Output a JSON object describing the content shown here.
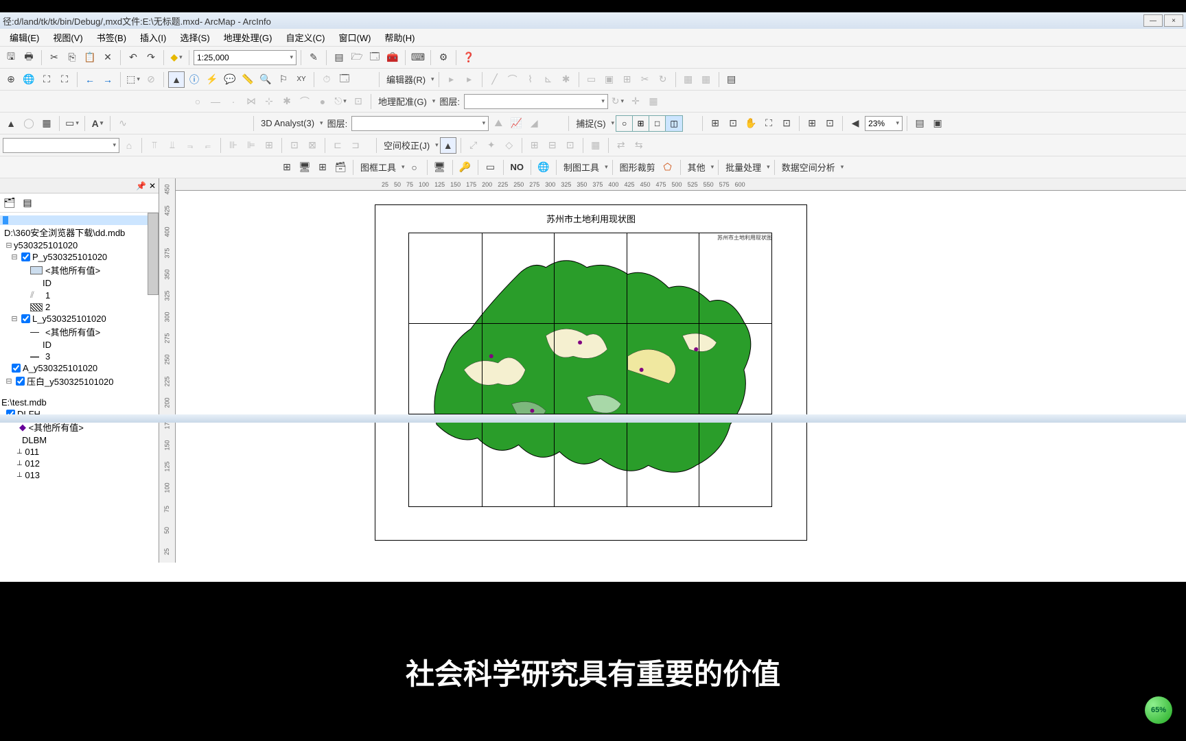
{
  "title": "径:d/land/tk/tk/bin/Debug/,mxd文件:E:\\无标题.mxd- ArcMap - ArcInfo",
  "window_controls": {
    "minimize": "—",
    "close": "×"
  },
  "menu": {
    "edit": "编辑(E)",
    "view": "视图(V)",
    "bookmark": "书签(B)",
    "insert": "插入(I)",
    "select": "选择(S)",
    "geoproc": "地理处理(G)",
    "custom": "自定义(C)",
    "window": "窗口(W)",
    "help": "帮助(H)"
  },
  "scale": "1:25,000",
  "zoom_pct": "23%",
  "editor_label": "编辑器(R)",
  "georef_label": "地理配准(G)",
  "layer_label": "图层:",
  "snap_label": "捕捉(S)",
  "analyst3d_label": "3D Analyst(3)",
  "spatial_adj_label": "空间校正(J)",
  "frame_tool_label": "图框工具",
  "no_label": "NO",
  "carto_tool_label": "制图工具",
  "clip_label": "图形裁剪",
  "other_label": "其他",
  "batch_label": "批量处理",
  "data_spatial_label": "数据空间分析",
  "ruler_h": [
    "25",
    "50",
    "75",
    "100",
    "125",
    "150",
    "175",
    "200",
    "225",
    "250",
    "275",
    "300",
    "325",
    "350",
    "375",
    "400",
    "425",
    "450",
    "475",
    "500",
    "525",
    "550",
    "575",
    "600"
  ],
  "ruler_v": [
    "450",
    "425",
    "400",
    "375",
    "350",
    "325",
    "300",
    "275",
    "250",
    "225",
    "200",
    "175",
    "150",
    "125",
    "100",
    "75",
    "50",
    "25"
  ],
  "map_title": "苏州市土地利用现状图",
  "legend_text": "苏州市土地利用现状图",
  "toc": {
    "db1": "D:\\360安全浏览器下载\\dd.mdb",
    "layer_y": "y530325101020",
    "layer_p": "P_y530325101020",
    "other_vals": "<其他所有值>",
    "id_field": "ID",
    "val_1": "1",
    "val_2": "2",
    "layer_l": "L_y530325101020",
    "val_3": "3",
    "layer_a": "A_y530325101020",
    "layer_blank": "压白_y530325101020",
    "db2": "E:\\test.mdb",
    "layer_dlfh": "DLFH",
    "dlbm": "DLBM",
    "code_011": "011",
    "code_012": "012",
    "code_013": "013"
  },
  "subtitle": "社会科学研究具有重要的价值",
  "progress": "65%"
}
